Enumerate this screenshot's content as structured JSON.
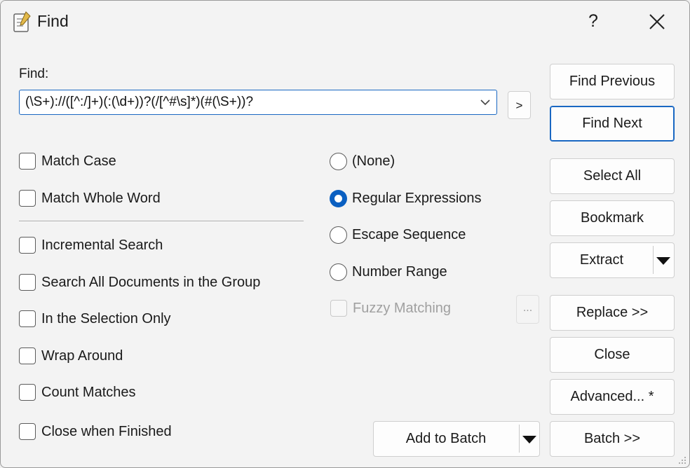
{
  "window": {
    "title": "Find",
    "help": "?",
    "icons": {
      "app": "notepad-icon",
      "close": "close-icon",
      "dropdown": "chevron-down-icon",
      "split": "triangle-down-icon"
    }
  },
  "find": {
    "label": "Find:",
    "value": "(\\S+)://([^:/]+)(:(\\d+))?(/[^#\\s]*)(#(\\S+))?",
    "expand_button": ">"
  },
  "options": {
    "match_case": {
      "label": "Match Case",
      "checked": false
    },
    "match_whole_word": {
      "label": "Match Whole Word",
      "checked": false
    },
    "incremental_search": {
      "label": "Incremental Search",
      "checked": false
    },
    "search_all_documents": {
      "label": "Search All Documents in the Group",
      "checked": false
    },
    "selection_only": {
      "label": "In the Selection Only",
      "checked": false
    },
    "wrap_around": {
      "label": "Wrap Around",
      "checked": false
    },
    "count_matches": {
      "label": "Count Matches",
      "checked": false
    },
    "close_when_finished": {
      "label": "Close when Finished",
      "checked": false
    }
  },
  "mode": {
    "none": {
      "label": "(None)",
      "selected": false
    },
    "regex": {
      "label": "Regular Expressions",
      "selected": true
    },
    "escape": {
      "label": "Escape Sequence",
      "selected": false
    },
    "number_range": {
      "label": "Number Range",
      "selected": false
    },
    "fuzzy": {
      "label": "Fuzzy Matching",
      "enabled": false
    },
    "fuzzy_options": "..."
  },
  "buttons": {
    "find_previous": "Find Previous",
    "find_next": "Find Next",
    "select_all": "Select All",
    "bookmark": "Bookmark",
    "extract": "Extract",
    "replace": "Replace >>",
    "close": "Close",
    "advanced": "Advanced... *",
    "batch": "Batch >>",
    "add_to_batch": "Add to Batch"
  },
  "colors": {
    "accent": "#0a5fc1",
    "focus_border": "#1967c2"
  }
}
